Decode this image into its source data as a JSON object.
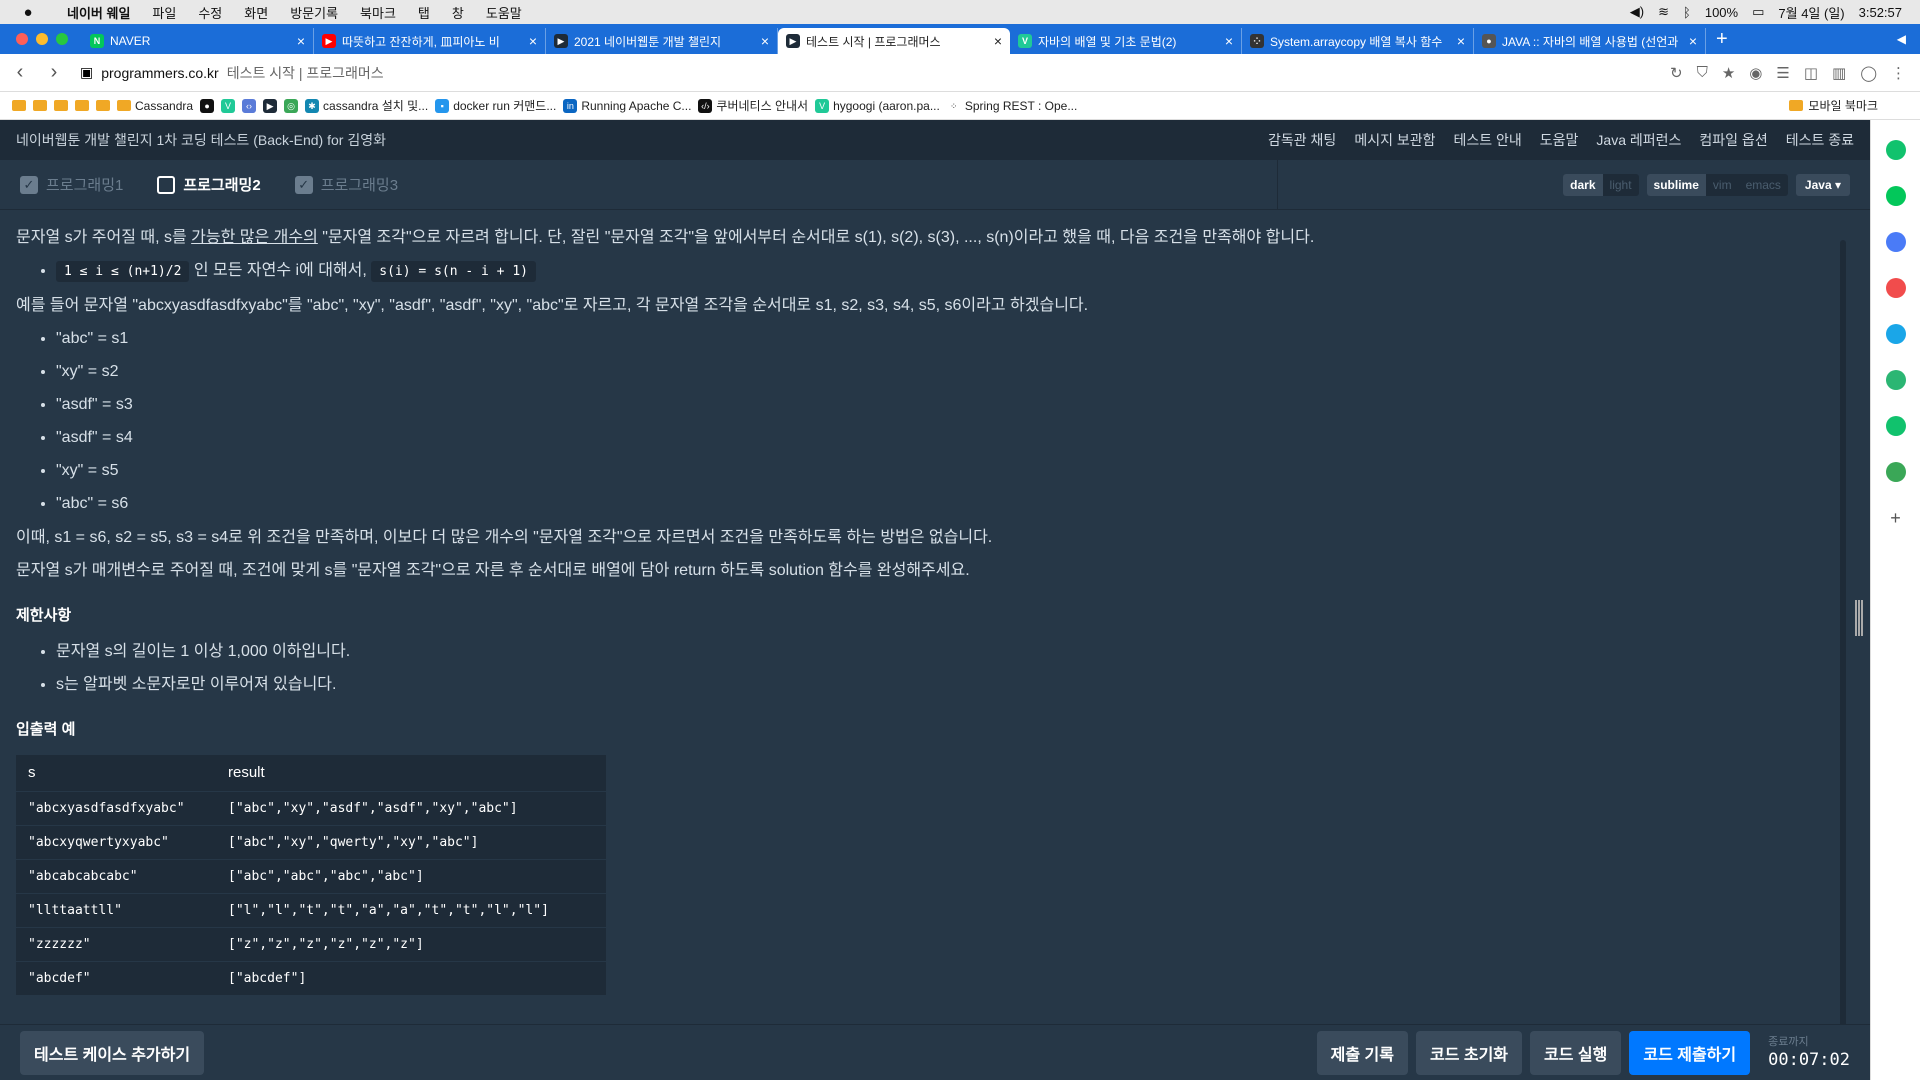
{
  "menubar": {
    "app": "네이버 웨일",
    "items": [
      "파일",
      "수정",
      "화면",
      "방문기록",
      "북마크",
      "탭",
      "창",
      "도움말"
    ],
    "battery": "100%",
    "date": "7월 4일 (일)",
    "time": "3:52:57"
  },
  "tabs": [
    {
      "title": "NAVER",
      "icon": "N",
      "color": "#03c75a"
    },
    {
      "title": "따뜻하고 잔잔하게, 皿피아노 비",
      "icon": "▶",
      "color": "#ff0000"
    },
    {
      "title": "2021 네이버웹툰 개발 챌린지",
      "icon": "▶",
      "color": "#1e2b38"
    },
    {
      "title": "테스트 시작 | 프로그래머스",
      "icon": "▶",
      "color": "#1e2b38",
      "active": true
    },
    {
      "title": "자바의 배열 및 기초 문법(2)",
      "icon": "V",
      "color": "#20c997"
    },
    {
      "title": "System.arraycopy 배열 복사 함수",
      "icon": "⁘",
      "color": "#333"
    },
    {
      "title": "JAVA :: 자바의 배열 사용법 (선언과",
      "icon": "●",
      "color": "#555"
    }
  ],
  "address": {
    "domain": "programmers.co.kr",
    "title": "테스트 시작 | 프로그래머스"
  },
  "bookmarks": [
    "Cassandra",
    "cassandra 설치 및...",
    "docker run 커맨드...",
    "Running Apache C...",
    "쿠버네티스 안내서",
    "hygoogi (aaron.pa...",
    "Spring REST : Ope..."
  ],
  "bookmarks_mobile": "모바일 북마크",
  "header": {
    "title": "네이버웹툰 개발 챌린지 1차 코딩 테스트 (Back-End) for 김영화",
    "links": [
      "감독관 채팅",
      "메시지 보관함",
      "테스트 안내",
      "도움말",
      "Java 레퍼런스",
      "컴파일 옵션",
      "테스트 종료"
    ]
  },
  "prog_tabs": [
    {
      "label": "프로그래밍1",
      "done": true
    },
    {
      "label": "프로그래밍2",
      "active": true
    },
    {
      "label": "프로그래밍3",
      "done": true
    }
  ],
  "theme": [
    "dark",
    "light"
  ],
  "keymap": [
    "sublime",
    "vim",
    "emacs"
  ],
  "language": "Java",
  "problem": {
    "intro_a": "문자열 s가 주어질 때, s를 ",
    "intro_u": "가능한 많은 개수의",
    "intro_b": " \"문자열 조각\"으로 자르려 합니다. 단, 잘린 \"문자열 조각\"을 앞에서부터 순서대로 s(1), s(2), s(3), ..., s(n)이라고 했을 때, 다음 조건을 만족해야 합니다.",
    "cond_code1": "1 ≤ i ≤ (n+1)/2",
    "cond_text": " 인 모든 자연수 i에 대해서, ",
    "cond_code2": "s(i) = s(n - i + 1)",
    "example": "예를 들어 문자열 \"abcxyasdfasdfxyabc\"를 \"abc\", \"xy\", \"asdf\", \"asdf\", \"xy\", \"abc\"로 자르고, 각 문자열 조각을 순서대로 s1, s2, s3, s4, s5, s6이라고 하겠습니다.",
    "pieces": [
      "\"abc\" = s1",
      "\"xy\" = s2",
      "\"asdf\" = s3",
      "\"asdf\" = s4",
      "\"xy\" = s5",
      "\"abc\" = s6"
    ],
    "note": "이때, s1 = s6, s2 = s5, s3 = s4로 위 조건을 만족하며, 이보다 더 많은 개수의 \"문자열 조각\"으로 자르면서 조건을 만족하도록 하는 방법은 없습니다.",
    "task": "문자열 s가 매개변수로 주어질 때, 조건에 맞게 s를 \"문자열 조각\"으로 자른 후 순서대로 배열에 담아 return 하도록 solution 함수를 완성해주세요.",
    "limits_title": "제한사항",
    "limits": [
      "문자열 s의 길이는 1 이상 1,000 이하입니다.",
      "s는 알파벳 소문자로만 이루어져 있습니다."
    ],
    "io_title": "입출력 예",
    "io_headers": [
      "s",
      "result"
    ],
    "io_rows": [
      [
        "\"abcxyasdfasdfxyabc\"",
        "[\"abc\",\"xy\",\"asdf\",\"asdf\",\"xy\",\"abc\"]"
      ],
      [
        "\"abcxyqwertyxyabc\"",
        "[\"abc\",\"xy\",\"qwerty\",\"xy\",\"abc\"]"
      ],
      [
        "\"abcabcabcabc\"",
        "[\"abc\",\"abc\",\"abc\",\"abc\"]"
      ],
      [
        "\"llttaattll\"",
        "[\"l\",\"l\",\"t\",\"t\",\"a\",\"a\",\"t\",\"t\",\"l\",\"l\"]"
      ],
      [
        "\"zzzzzz\"",
        "[\"z\",\"z\",\"z\",\"z\",\"z\",\"z\"]"
      ],
      [
        "\"abcdef\"",
        "[\"abcdef\"]"
      ]
    ]
  },
  "footer": {
    "add_case": "테스트 케이스 추가하기",
    "history": "제출 기록",
    "reset": "코드 초기화",
    "run": "코드 실행",
    "submit": "코드 제출하기",
    "timer_label": "종료까지",
    "timer": "00:07:02"
  }
}
